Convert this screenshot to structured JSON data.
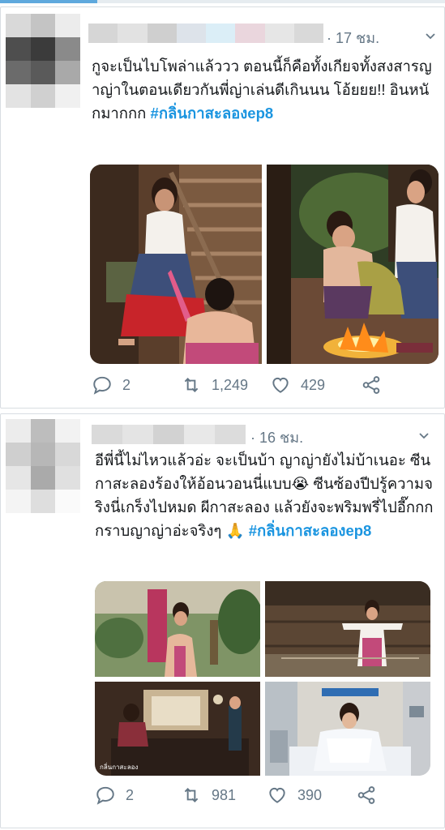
{
  "tweets": [
    {
      "time": "· 17 ชม.",
      "text_main": "กูจะเป็นไบโพล่าแล้ววว ตอนนี้ก็คือทั้งเกียจทั้งสงสารญาญ่าในตอนเดียวกันพี่ญ่าเล่นดีเกินนน โอ้ยยย!! อินหนักมากกก ",
      "hashtag": "#กลิ่นกาสะลองep8",
      "replies": "2",
      "retweets": "1,249",
      "likes": "429"
    },
    {
      "time": "· 16 ชม.",
      "text_main": "อีพี่นี้ไม่ไหวแล้วอ่ะ จะเป็นบ้า ญาญ่ายังไม่บ้าเนอะ ซีนกาสะลองร้องให้อ้อนวอนนี่แบบ😭 ซีนซ้องปีปรู้ความจริงนี่เกร็งไปหมด ผีกาสะลอง แล้วยังจะพริมพรี่ไปอี๊กกก กราบญาญ่าอ่ะจริงๆ 🙏 ",
      "hashtag": "#กลิ่นกาสะลองep8",
      "replies": "2",
      "retweets": "981",
      "likes": "390",
      "image_caption": "กลิ่นกาสะลอง"
    }
  ],
  "icons": {
    "reply": "reply-icon",
    "retweet": "retweet-icon",
    "like": "like-icon",
    "share": "share-icon",
    "more": "chevron-down-icon"
  },
  "colors": {
    "hashtag": "#1b95e0",
    "secondary_text": "#657786",
    "border": "#d8dde2"
  }
}
